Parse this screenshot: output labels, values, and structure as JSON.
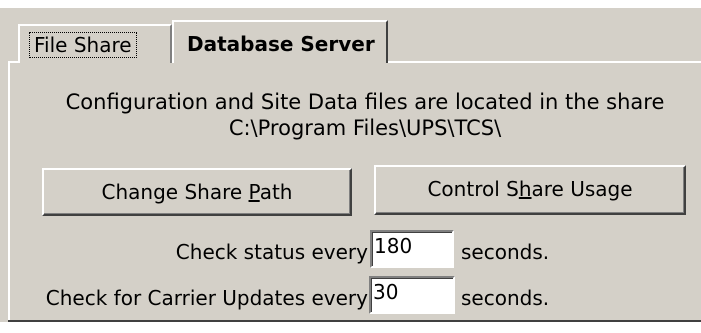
{
  "tabs": [
    {
      "label": "File Share"
    },
    {
      "label": "Database Server"
    }
  ],
  "message": {
    "line1": "Configuration and Site Data files are located in the share",
    "line2": "C:\\Program Files\\UPS\\TCS\\"
  },
  "buttons": {
    "change_share_path": {
      "pre": "Change Share ",
      "access": "P",
      "post": "ath"
    },
    "control_share_usage": {
      "pre": "Control S",
      "access": "h",
      "post": "are Usage"
    }
  },
  "status_check": {
    "label": "Check status every",
    "value": "180",
    "unit": "seconds."
  },
  "carrier_updates": {
    "label": "Check for Carrier Updates every",
    "value": "30",
    "unit": "seconds."
  }
}
